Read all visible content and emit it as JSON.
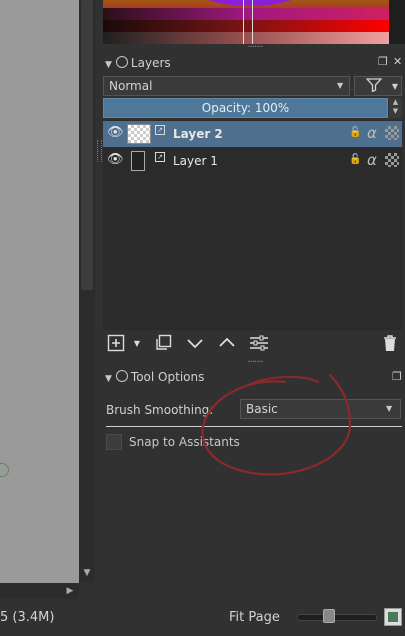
{
  "layers_panel": {
    "title": "Layers",
    "blend_mode": "Normal",
    "opacity_label": "Opacity:  100%",
    "layers": [
      {
        "name": "Layer 2",
        "selected": true
      },
      {
        "name": "Layer 1",
        "selected": false
      }
    ],
    "toolbar_icons": [
      "add-layer-icon",
      "dropdown-icon",
      "duplicate-layer-icon",
      "move-down-icon",
      "move-up-icon",
      "layer-properties-icon",
      "delete-layer-icon"
    ]
  },
  "tool_options": {
    "title": "Tool Options",
    "brush_smoothing_label": "Brush Smoothing:",
    "brush_smoothing_value": "Basic",
    "snap_label": "Snap to Assistants",
    "snap_checked": false
  },
  "status_bar": {
    "size_text": "5 (3.4M)",
    "zoom_label": "Fit Page",
    "zoom_level": 0.38
  },
  "colors": {
    "accent": "#4f7799",
    "selected_row": "#4e6f8d",
    "annotation": "#8a2a2a"
  }
}
